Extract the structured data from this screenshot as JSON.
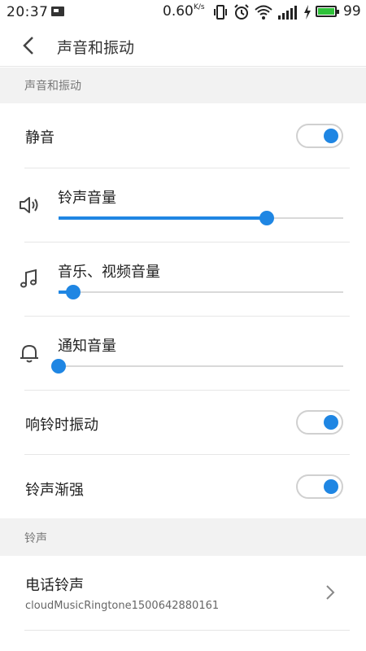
{
  "status_bar": {
    "time": "20:37",
    "net_speed": "0.60",
    "net_speed_unit": "K/s",
    "battery_percent": "99",
    "battery_level": 0.99,
    "icons": [
      "mail-icon",
      "vibrate-icon",
      "alarm-icon",
      "wifi-icon",
      "signal-icon",
      "charging-icon",
      "battery-icon"
    ]
  },
  "header": {
    "title": "声音和振动"
  },
  "sections": {
    "sound_vibration": "声音和振动",
    "ringtone": "铃声"
  },
  "items": {
    "mute": {
      "label": "静音",
      "on": true
    },
    "ring_volume": {
      "label": "铃声音量",
      "value": 0.73,
      "icon": "speaker-icon"
    },
    "media_volume": {
      "label": "音乐、视频音量",
      "value": 0.05,
      "icon": "music-note-icon"
    },
    "notify_volume": {
      "label": "通知音量",
      "value": 0.0,
      "icon": "bell-icon"
    },
    "vibrate_on_ring": {
      "label": "响铃时振动",
      "on": true
    },
    "ring_crescendo": {
      "label": "铃声渐强",
      "on": true
    },
    "phone_ringtone": {
      "label": "电话铃声",
      "value": "cloudMusicRingtone1500642880161"
    }
  },
  "colors": {
    "accent": "#1f86e3",
    "section_bg": "#f2f2f2",
    "battery": "#2fc23a"
  }
}
